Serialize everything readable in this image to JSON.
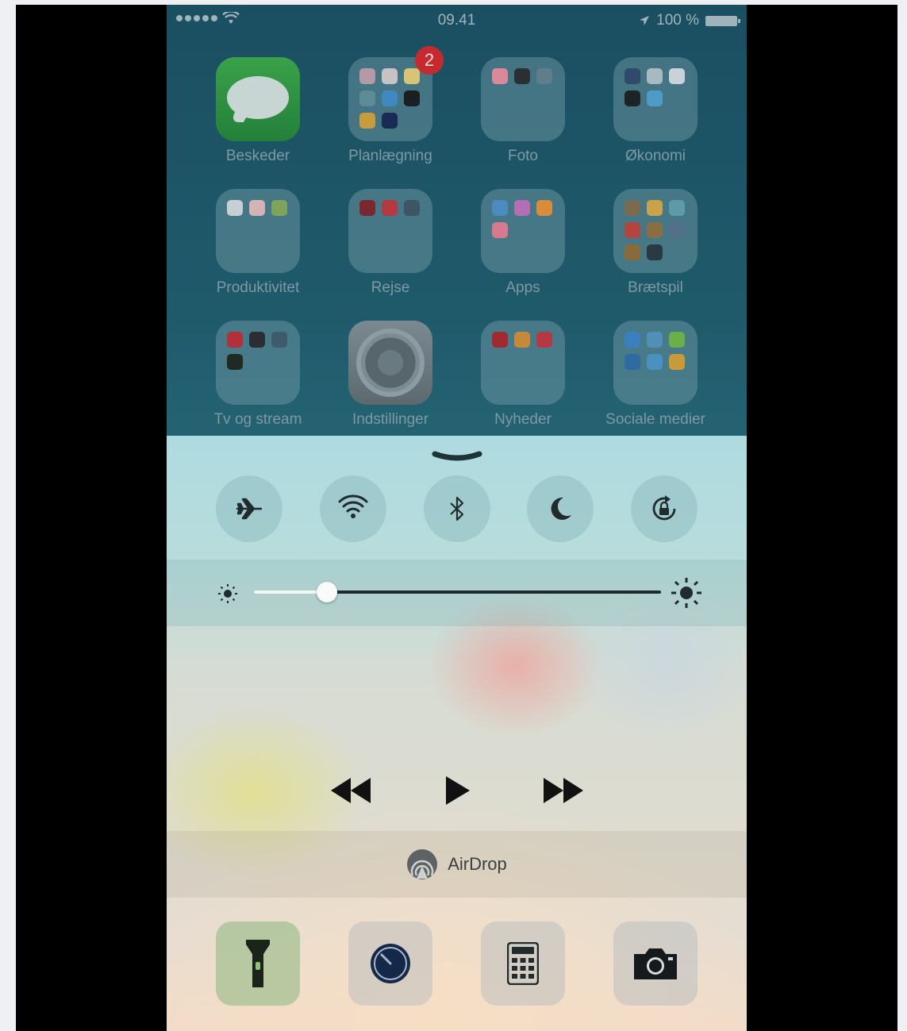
{
  "status_bar": {
    "time": "09.41",
    "battery": "100 %",
    "signal_icon": "signal-dots-icon",
    "wifi_icon": "wifi-icon",
    "location_icon": "location-arrow-icon"
  },
  "home_screen": {
    "apps": [
      {
        "label": "Beskeder",
        "type": "app"
      },
      {
        "label": "Planlægning",
        "type": "folder",
        "badge": "2"
      },
      {
        "label": "Foto",
        "type": "folder"
      },
      {
        "label": "Økonomi",
        "type": "folder"
      },
      {
        "label": "Produktivitet",
        "type": "folder"
      },
      {
        "label": "Rejse",
        "type": "folder"
      },
      {
        "label": "Apps",
        "type": "folder"
      },
      {
        "label": "Brætspil",
        "type": "folder"
      },
      {
        "label": "Tv og stream",
        "type": "folder"
      },
      {
        "label": "Indstillinger",
        "type": "app"
      },
      {
        "label": "Nyheder",
        "type": "folder"
      },
      {
        "label": "Sociale medier",
        "type": "folder"
      }
    ]
  },
  "control_center": {
    "toggles": [
      {
        "name": "airplane-mode",
        "icon": "airplane-icon"
      },
      {
        "name": "wifi",
        "icon": "wifi-icon"
      },
      {
        "name": "bluetooth",
        "icon": "bluetooth-icon"
      },
      {
        "name": "do-not-disturb",
        "icon": "moon-icon"
      },
      {
        "name": "rotation-lock",
        "icon": "rotation-lock-icon"
      }
    ],
    "brightness": 0.18,
    "media_controls": [
      "rewind-icon",
      "play-icon",
      "fast-forward-icon"
    ],
    "airdrop_label": "AirDrop",
    "shortcuts": [
      {
        "name": "flashlight",
        "icon": "flashlight-icon",
        "active": true
      },
      {
        "name": "timer",
        "icon": "timer-icon"
      },
      {
        "name": "calculator",
        "icon": "calculator-icon"
      },
      {
        "name": "camera",
        "icon": "camera-icon"
      }
    ]
  },
  "colors": {
    "badge": "#c62a2f",
    "home_label": "#7d99a3",
    "icon_dark": "#1f2b2c"
  }
}
